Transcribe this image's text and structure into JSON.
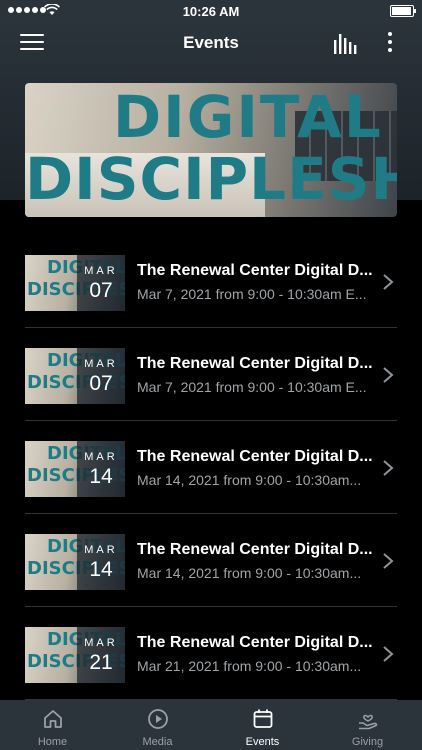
{
  "status": {
    "time": "10:26 AM"
  },
  "header": {
    "title": "Events"
  },
  "banner": {
    "line1": "DIGITAL",
    "line2": "DISCIPLESHIP"
  },
  "events": [
    {
      "month": "MAR",
      "day": "07",
      "title": "The Renewal Center Digital D...",
      "subtitle": "Mar 7, 2021 from 9:00 - 10:30am E..."
    },
    {
      "month": "MAR",
      "day": "07",
      "title": "The Renewal Center Digital D...",
      "subtitle": "Mar 7, 2021 from 9:00 - 10:30am E..."
    },
    {
      "month": "MAR",
      "day": "14",
      "title": "The Renewal Center Digital D...",
      "subtitle": "Mar 14, 2021 from 9:00 - 10:30am..."
    },
    {
      "month": "MAR",
      "day": "14",
      "title": "The Renewal Center Digital D...",
      "subtitle": "Mar 14, 2021 from 9:00 - 10:30am..."
    },
    {
      "month": "MAR",
      "day": "21",
      "title": "The Renewal Center Digital D...",
      "subtitle": "Mar 21, 2021 from 9:00 - 10:30am..."
    }
  ],
  "tabs": [
    {
      "label": "Home",
      "icon": "home-icon"
    },
    {
      "label": "Media",
      "icon": "play-icon"
    },
    {
      "label": "Events",
      "icon": "calendar-icon"
    },
    {
      "label": "Giving",
      "icon": "giving-hand-icon"
    }
  ],
  "colors": {
    "accent": "#1f7c86",
    "bar": "#2b333b",
    "background": "#000000",
    "muted_text": "#a0a4a8"
  }
}
